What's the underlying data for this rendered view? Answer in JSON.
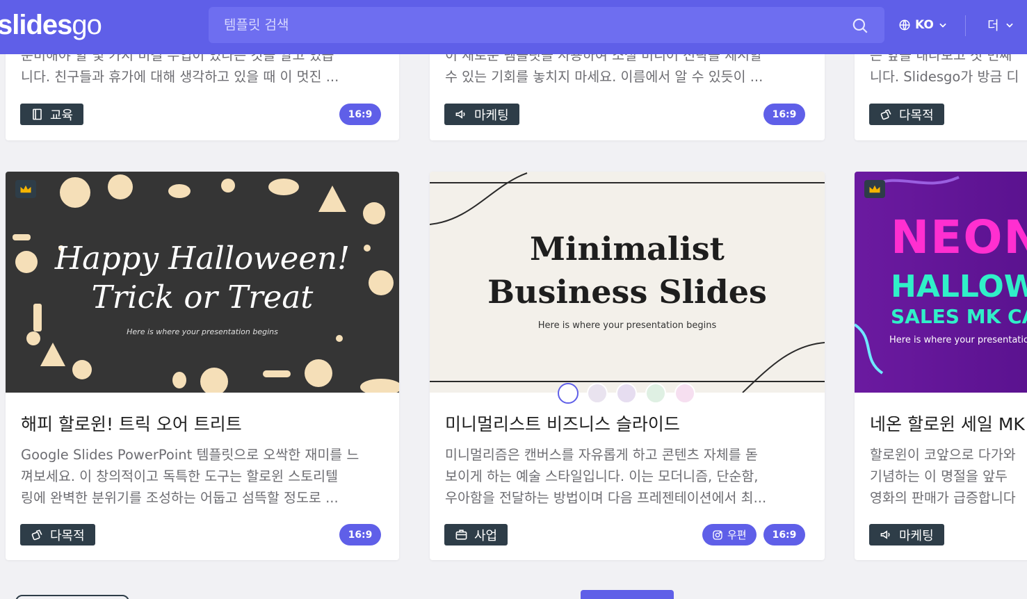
{
  "header": {
    "logo_main": "slides",
    "logo_go": "go",
    "search_placeholder": "템플릿 검색",
    "language": "KO",
    "more": "더"
  },
  "colors": {
    "brand": "#5f5fe8",
    "category_tag": "#2e3d48",
    "card_bg": "#ffffff"
  },
  "top_cards": [
    {
      "desc": [
        "준비해야 할 몇 가지 비결 무엽이 있다는 것을 알고 있습",
        "니다. 친구들과 휴가에 대해 생각하고 있을 때 이 멋진 ..."
      ],
      "category": "교육",
      "category_icon": "book-icon",
      "ratio": "16:9"
    },
    {
      "desc": [
        "이 새로운 템플릿을 사용하여 소셜 미디어 전략을 제시할",
        "수 있는 기회를 놓치지 마세요. 이름에서 알 수 있듯이 ..."
      ],
      "category": "마케팅",
      "category_icon": "megaphone-icon",
      "ratio": "16:9"
    },
    {
      "desc": [
        "는 앞을 내다보고 첫 번째",
        "니다. Slidesgo가 방금 디"
      ],
      "category": "다목적",
      "category_icon": "multipurpose-icon"
    }
  ],
  "cards": [
    {
      "thumb_title_1": "Happy Halloween!",
      "thumb_title_2": "Trick or Treat",
      "thumb_sub": "Here is where your presentation begins",
      "title": "해피 할로윈! 트릭 오어 트리트",
      "desc": [
        "Google Slides PowerPoint 템플릿으로 오싹한 재미를 느",
        "껴보세요. 이 창의적이고 독특한 도구는 할로윈 스토리텔",
        "링에 완벽한 분위기를 조성하는 어둡고 섬뜩할 정도로 ..."
      ],
      "category": "다목적",
      "category_icon": "multipurpose-icon",
      "ratio": "16:9"
    },
    {
      "thumb_title_1": "Minimalist",
      "thumb_title_2": "Business Slides",
      "thumb_sub": "Here is where your presentation begins",
      "title": "미니멀리스트 비즈니스 슬라이드",
      "desc": [
        "미니멀리즘은 캔버스를 자유롭게 하고 콘텐츠 자체를 돋",
        "보이게 하는 예술 스타일입니다. 이는 모더니즘, 단순함,",
        "우아함을 전달하는 방법이며 다음 프레젠테이션에서 최..."
      ],
      "category": "사업",
      "category_icon": "briefcase-icon",
      "fav": "우편",
      "ratio": "16:9",
      "swatches": [
        "#ffffff",
        "#e9e3ef",
        "#e6ddf0",
        "#dff0e3",
        "#f6dff0"
      ]
    },
    {
      "thumb_title_1": "NEON",
      "thumb_title_2": "HALLOWEEN",
      "thumb_title_3": "SALES MK CAMP",
      "thumb_sub": "Here is where your presentation b",
      "title": "네온 할로윈 세일 MK",
      "desc": [
        "할로윈이 코앞으로 다가와",
        "기념하는 이 명절을 앞두",
        "영화의 판매가 급증합니다"
      ],
      "category": "마케팅",
      "category_icon": "megaphone-icon"
    }
  ]
}
